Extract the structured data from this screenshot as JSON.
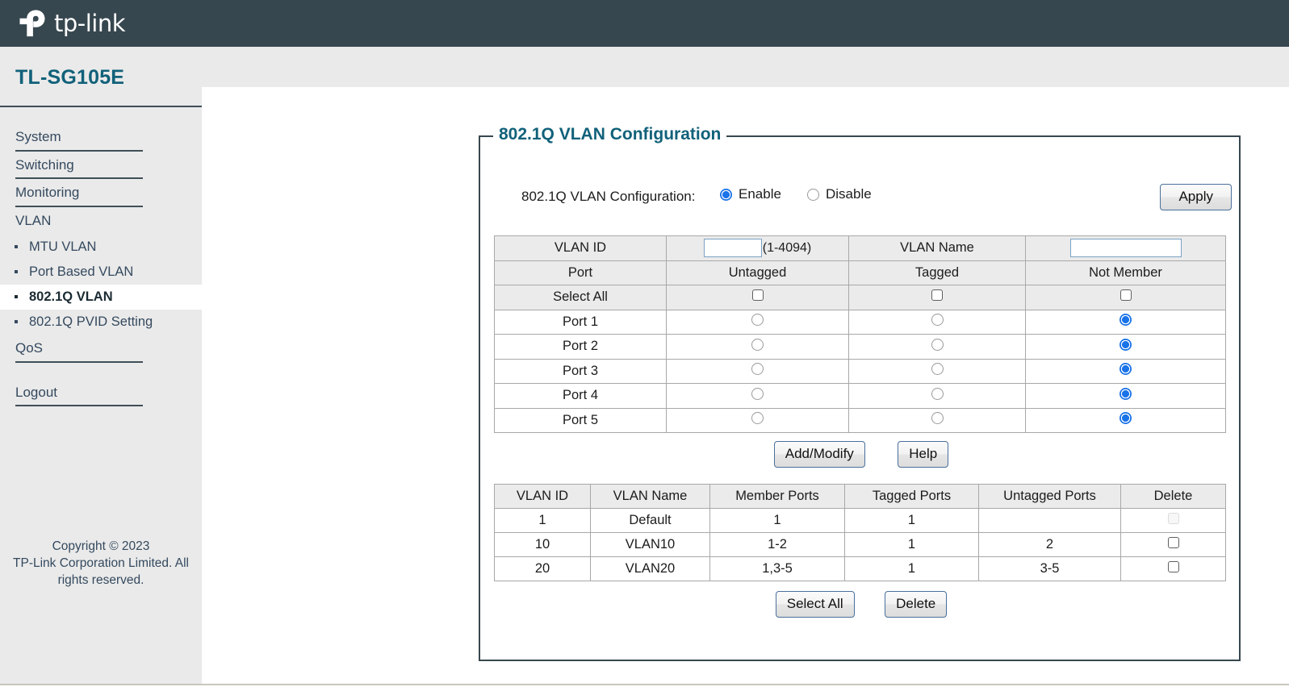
{
  "brand": {
    "name": "tp-link",
    "logo_icon": "tp-link-logo-icon"
  },
  "device": {
    "model": "TL-SG105E"
  },
  "sidebar": {
    "top_items": [
      {
        "label": "System"
      },
      {
        "label": "Switching"
      },
      {
        "label": "Monitoring"
      },
      {
        "label": "VLAN"
      }
    ],
    "vlan_subitems": [
      {
        "label": "MTU VLAN",
        "active": false
      },
      {
        "label": "Port Based VLAN",
        "active": false
      },
      {
        "label": "802.1Q VLAN",
        "active": true
      },
      {
        "label": "802.1Q PVID Setting",
        "active": false
      }
    ],
    "qos_label": "QoS",
    "logout_label": "Logout",
    "copyright_line1": "Copyright © 2023",
    "copyright_line2": "TP-Link Corporation Limited. All",
    "copyright_line3": "rights reserved."
  },
  "panel": {
    "legend": "802.1Q VLAN Configuration",
    "enable_label": "802.1Q VLAN Configuration:",
    "option_enable": "Enable",
    "option_disable": "Disable",
    "selected_option": "Enable",
    "apply_label": "Apply"
  },
  "vlan_config": {
    "vlan_id_label": "VLAN ID",
    "vlan_id_value": "",
    "vlan_id_placeholder": "",
    "vlan_id_hint": "(1-4094)",
    "vlan_name_label": "VLAN Name",
    "vlan_name_value": "",
    "vlan_name_placeholder": "",
    "col_port": "Port",
    "col_untagged": "Untagged",
    "col_tagged": "Tagged",
    "col_not_member": "Not Member",
    "select_all_label": "Select All",
    "select_all_untagged_checked": false,
    "select_all_tagged_checked": false,
    "select_all_notmember_checked": false,
    "ports": [
      {
        "label": "Port 1",
        "selection": "Not Member"
      },
      {
        "label": "Port 2",
        "selection": "Not Member"
      },
      {
        "label": "Port 3",
        "selection": "Not Member"
      },
      {
        "label": "Port 4",
        "selection": "Not Member"
      },
      {
        "label": "Port 5",
        "selection": "Not Member"
      }
    ],
    "add_modify_label": "Add/Modify",
    "help_label": "Help"
  },
  "vlan_list": {
    "columns": [
      "VLAN ID",
      "VLAN Name",
      "Member Ports",
      "Tagged Ports",
      "Untagged Ports",
      "Delete"
    ],
    "rows": [
      {
        "vlan_id": "1",
        "vlan_name": "Default",
        "member_ports": "1",
        "tagged_ports": "1",
        "untagged_ports": "",
        "delete_checked": false,
        "delete_disabled": true
      },
      {
        "vlan_id": "10",
        "vlan_name": "VLAN10",
        "member_ports": "1-2",
        "tagged_ports": "1",
        "untagged_ports": "2",
        "delete_checked": false,
        "delete_disabled": false
      },
      {
        "vlan_id": "20",
        "vlan_name": "VLAN20",
        "member_ports": "1,3-5",
        "tagged_ports": "1",
        "untagged_ports": "3-5",
        "delete_checked": false,
        "delete_disabled": false
      }
    ],
    "select_all_label": "Select All",
    "delete_label": "Delete"
  },
  "colors": {
    "topbar": "#37474f",
    "sidebar": "#eaeaea",
    "brand_teal": "#11617a",
    "accent_blue": "#1a73e8",
    "table_header": "#ebebeb"
  }
}
